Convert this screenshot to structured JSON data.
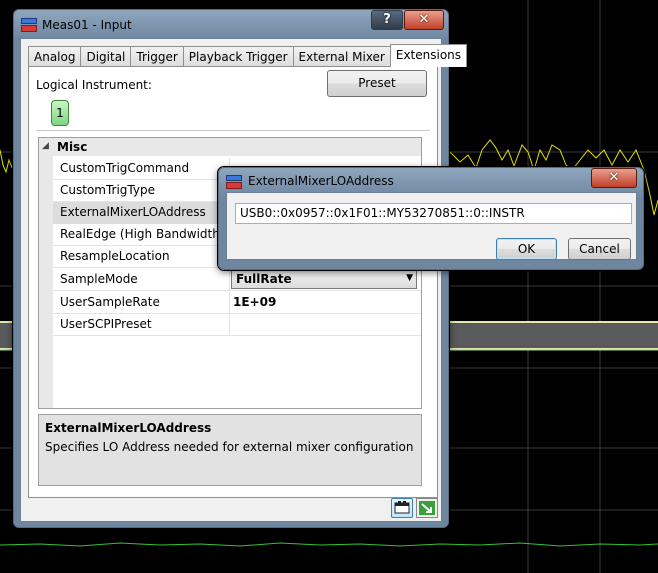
{
  "main_window": {
    "title": "Meas01 - Input",
    "help_btn": "?",
    "close_btn": "✕",
    "tabs": [
      "Analog",
      "Digital",
      "Trigger",
      "Playback Trigger",
      "External Mixer",
      "Extensions"
    ],
    "active_tab": 5,
    "logical_instrument_label": "Logical Instrument:",
    "logical_instrument_value": "1",
    "preset_label": "Preset",
    "category": "Misc",
    "properties": [
      {
        "name": "CustomTrigCommand",
        "value": ""
      },
      {
        "name": "CustomTrigType",
        "value": ""
      },
      {
        "name": "ExternalMixerLOAddress",
        "value": ""
      },
      {
        "name": "RealEdge (High Bandwidth)",
        "value": ""
      },
      {
        "name": "ResampleLocation",
        "value": ""
      },
      {
        "name": "SampleMode",
        "value": "FullRate"
      },
      {
        "name": "UserSampleRate",
        "value": "1E+09"
      },
      {
        "name": "UserSCPIPreset",
        "value": ""
      }
    ],
    "description_title": "ExternalMixerLOAddress",
    "description_text": "Specifies LO Address needed for external mixer configuration"
  },
  "popup": {
    "title": "ExternalMixerLOAddress",
    "close_btn": "✕",
    "address_value": "USB0::0x0957::0x1F01::MY53270851::0::INSTR",
    "ok_label": "OK",
    "cancel_label": "Cancel"
  },
  "colors": {
    "trace_yellow": "#e6e200",
    "trace_green": "#36c236",
    "background": "#000000"
  }
}
